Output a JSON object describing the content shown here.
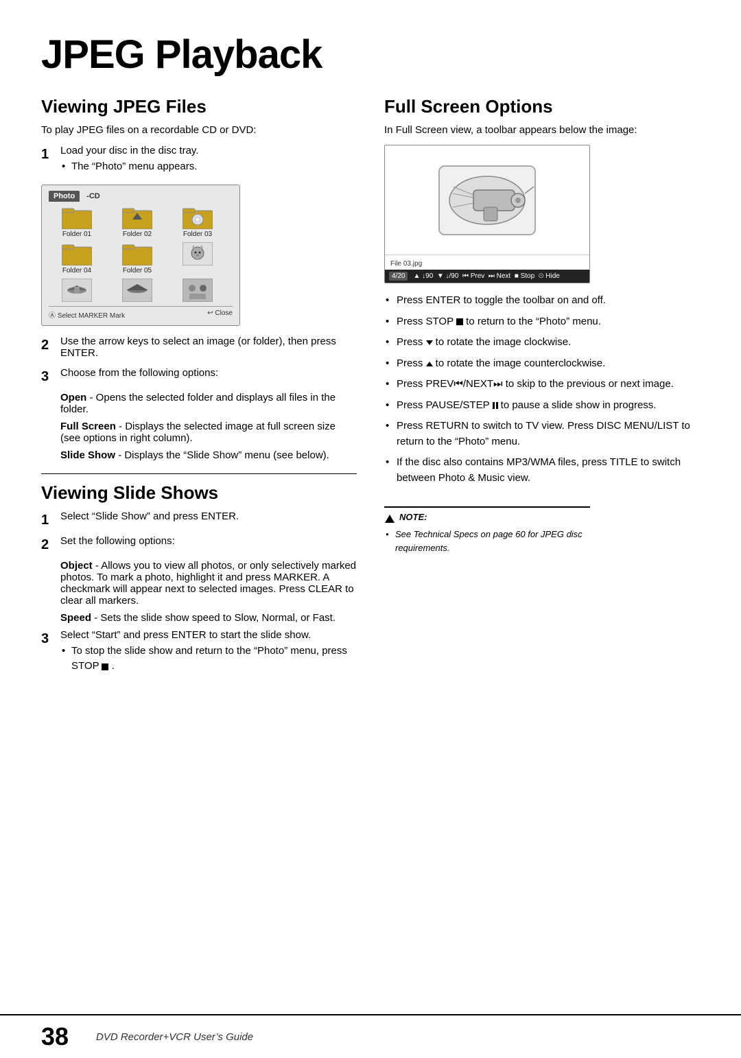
{
  "title": "JPEG Playback",
  "left_column": {
    "section1": {
      "heading": "Viewing JPEG Files",
      "intro": "To play JPEG files on a recordable CD or DVD:",
      "steps": [
        {
          "num": "1",
          "main": "Load your disc in the disc tray.",
          "bullets": [
            "The “Photo” menu appears."
          ]
        },
        {
          "num": "2",
          "main": "Use the arrow keys to select an image (or folder), then press ENTER."
        },
        {
          "num": "3",
          "main": "Choose from the following options:"
        }
      ],
      "options": [
        {
          "term": "Open",
          "desc": "- Opens the selected folder and displays all files in the folder."
        },
        {
          "term": "Full Screen",
          "desc": "- Displays the selected image at full screen size (see options in right column)."
        },
        {
          "term": "Slide Show",
          "desc": "- Displays the “Slide Show” menu (see below)."
        }
      ]
    },
    "section2": {
      "heading": "Viewing Slide Shows",
      "steps": [
        {
          "num": "1",
          "main": "Select “Slide Show” and press ENTER."
        },
        {
          "num": "2",
          "main": "Set the following options:"
        },
        {
          "num": "3",
          "main": "Select “Start” and press ENTER to start the slide show.",
          "bullets": [
            "To stop the slide show and return to the “Photo” menu, press STOP ■ ."
          ]
        }
      ],
      "options2": [
        {
          "term": "Object",
          "desc": "- Allows you to view all photos, or only selectively marked photos. To mark a photo, highlight it and press MARKER. A checkmark will appear next to selected images. Press CLEAR to clear all markers."
        },
        {
          "term": "Speed",
          "desc": "- Sets the slide show speed to Slow, Normal, or Fast."
        }
      ]
    }
  },
  "right_column": {
    "section": {
      "heading": "Full Screen Options",
      "intro": "In Full Screen view, a toolbar appears below the image:",
      "file_label": "File 03.jpg",
      "toolbar": "4/20  ▲ ↓90  ▼ ↓/90  ⏮ Prev  ⏭ Next  ■ Stop  Ⓘ Hide",
      "bullets": [
        "Press ENTER to toggle the toolbar on and off.",
        "Press STOP ■ to return to the “Photo” menu.",
        "Press ▼ to rotate the image clockwise.",
        "Press ▲ to rotate the image counterclockwise.",
        "Press PREV⏮/NEXT⏭ to skip to the previous or next image.",
        "Press PAUSE/STEP ⏸ to pause a slide show in progress.",
        "Press RETURN to switch to TV view. Press DISC MENU/LIST to return to the “Photo” menu.",
        "If the disc also contains MP3/WMA files, press TITLE to switch between Photo & Music view."
      ]
    },
    "note": {
      "title": "NOTE:",
      "bullets": [
        "See Technical Specs on page 60 for JPEG disc requirements."
      ]
    }
  },
  "footer": {
    "page_number": "38",
    "text": "DVD Recorder+VCR User’s Guide"
  },
  "photo_menu": {
    "tab": "Photo",
    "cd_label": "-CD",
    "folders": [
      {
        "label": "Folder 01",
        "type": "folder"
      },
      {
        "label": "Folder 02",
        "type": "folder"
      },
      {
        "label": "Folder 03",
        "type": "folder_cd"
      },
      {
        "label": "Folder 04",
        "type": "folder"
      },
      {
        "label": "Folder 05",
        "type": "folder"
      },
      {
        "label": "",
        "type": "image_cat"
      },
      {
        "label": "",
        "type": "image_plane1"
      },
      {
        "label": "",
        "type": "image_plane2"
      },
      {
        "label": "",
        "type": "image_mixed"
      }
    ],
    "footer_left": "Ⓐ Select  MARKER Mark",
    "footer_right": "↩ Close"
  }
}
